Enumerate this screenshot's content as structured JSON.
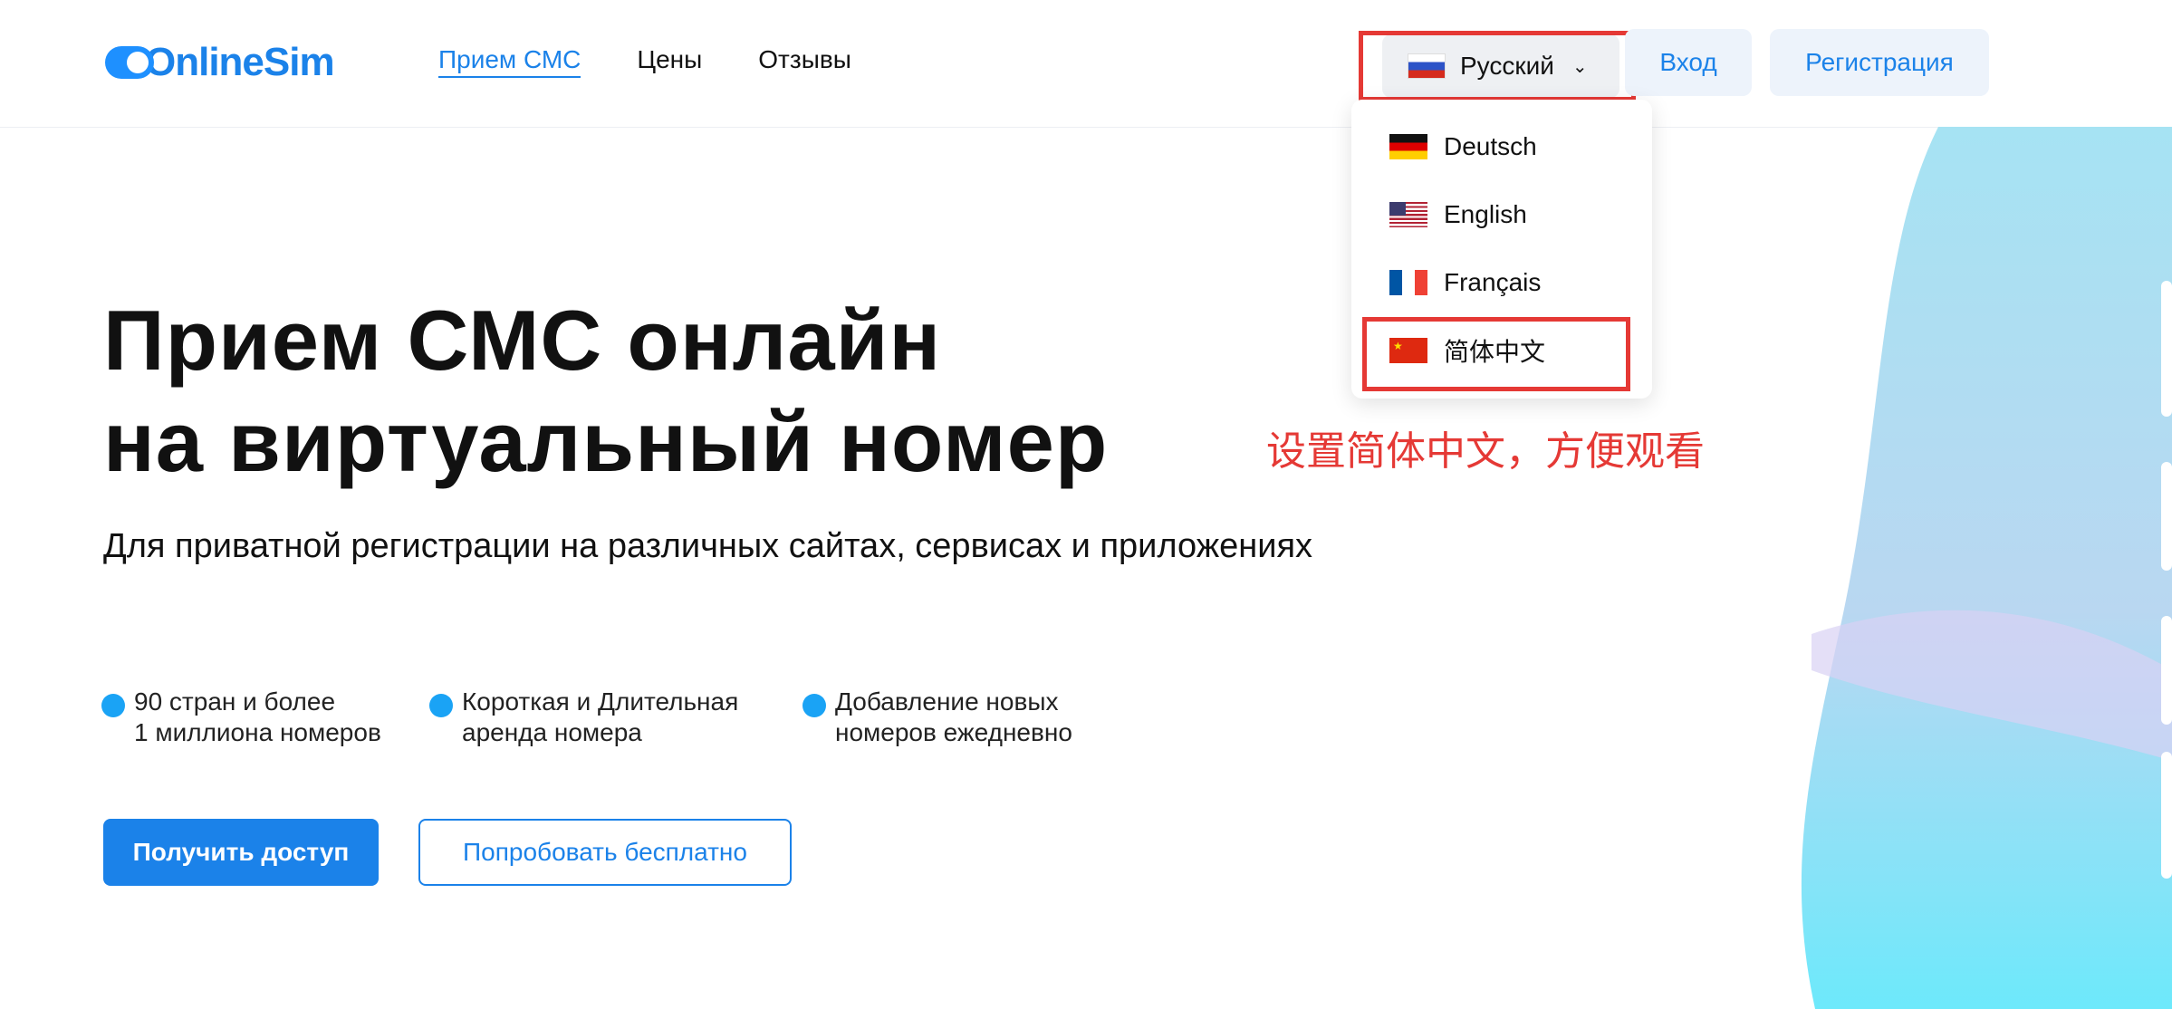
{
  "brand": {
    "name": "OnlineSim",
    "color": "#1b82e9"
  },
  "nav": {
    "items": [
      {
        "label": "Прием СМС",
        "active": true
      },
      {
        "label": "Цены"
      },
      {
        "label": "Отзывы"
      }
    ]
  },
  "language": {
    "current": "Русский",
    "options": [
      {
        "label": "Deutsch",
        "flag": "de"
      },
      {
        "label": "English",
        "flag": "us"
      },
      {
        "label": "Français",
        "flag": "fr"
      },
      {
        "label": "简体中文",
        "flag": "cn"
      }
    ]
  },
  "auth": {
    "login": "Вход",
    "register": "Регистрация"
  },
  "annotation": {
    "text": "设置简体中文，方便观看",
    "color": "#e53935"
  },
  "hero": {
    "title_line1": "Прием СМС онлайн",
    "title_line2": "на виртуальный номер",
    "subtitle": "Для приватной регистрации на различных сайтах, сервисах и приложениях"
  },
  "features": [
    {
      "line1": "90 стран и более",
      "line2": "1 миллиона номеров"
    },
    {
      "line1": "Короткая и Длительная",
      "line2": "аренда номера"
    },
    {
      "line1": "Добавление новых",
      "line2": "номеров ежедневно"
    }
  ],
  "cta": {
    "primary": "Получить доступ",
    "secondary": "Попробовать бесплатно"
  }
}
